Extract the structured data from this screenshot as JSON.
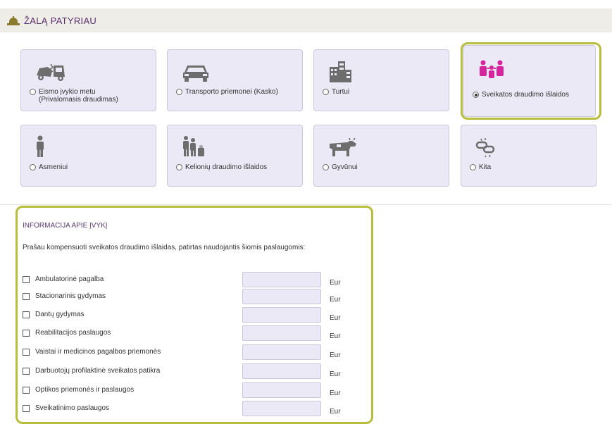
{
  "header": {
    "title": "ŽALĄ PATYRIAU",
    "icon": "bell-icon"
  },
  "categories": [
    {
      "label_line1": "Eismo įvykio metu",
      "label_line2": "(Privalomasis draudimas)",
      "icon": "car-crash-icon",
      "selected": false
    },
    {
      "label_line1": "Transporto priemonei (Kasko)",
      "label_line2": "",
      "icon": "car-icon",
      "selected": false
    },
    {
      "label_line1": "Turtui",
      "label_line2": "",
      "icon": "buildings-icon",
      "selected": false
    },
    {
      "label_line1": "Sveikatos draudimo išlaidos",
      "label_line2": "",
      "icon": "family-icon",
      "selected": true
    },
    {
      "label_line1": "Asmeniui",
      "label_line2": "",
      "icon": "person-icon",
      "selected": false
    },
    {
      "label_line1": "Kelionių draudimo išlaidos",
      "label_line2": "",
      "icon": "traveler-icon",
      "selected": false
    },
    {
      "label_line1": "Gyvūnui",
      "label_line2": "",
      "icon": "cow-icon",
      "selected": false
    },
    {
      "label_line1": "Kita",
      "label_line2": "",
      "icon": "link-icon",
      "selected": false
    }
  ],
  "info": {
    "title": "INFORMACIJA APIE ĮVYKĮ",
    "text": "Prašau kompensuoti sveikatos draudimo išlaidas, patirtas naudojantis šiomis paslaugomis:",
    "currency": "Eur",
    "items": [
      {
        "label": "Ambulatorinė pagalba",
        "value": ""
      },
      {
        "label": "Stacionarinis gydymas",
        "value": ""
      },
      {
        "label": "Dantų gydymas",
        "value": ""
      },
      {
        "label": "Reabilitacijos paslaugos",
        "value": ""
      },
      {
        "label": "Vaistai ir medicinos pagalbos priemonės",
        "value": ""
      },
      {
        "label": "Darbuotojų profilaktinė sveikatos patikra",
        "value": ""
      },
      {
        "label": "Optikos priemonės ir paslaugos",
        "value": ""
      },
      {
        "label": "Sveikatinimo paslaugos",
        "value": ""
      }
    ]
  },
  "colors": {
    "accent": "#b8bd3b",
    "brand": "#5a2d6e",
    "selected_icon": "#d6249f",
    "card_bg": "#ebe9f5"
  }
}
